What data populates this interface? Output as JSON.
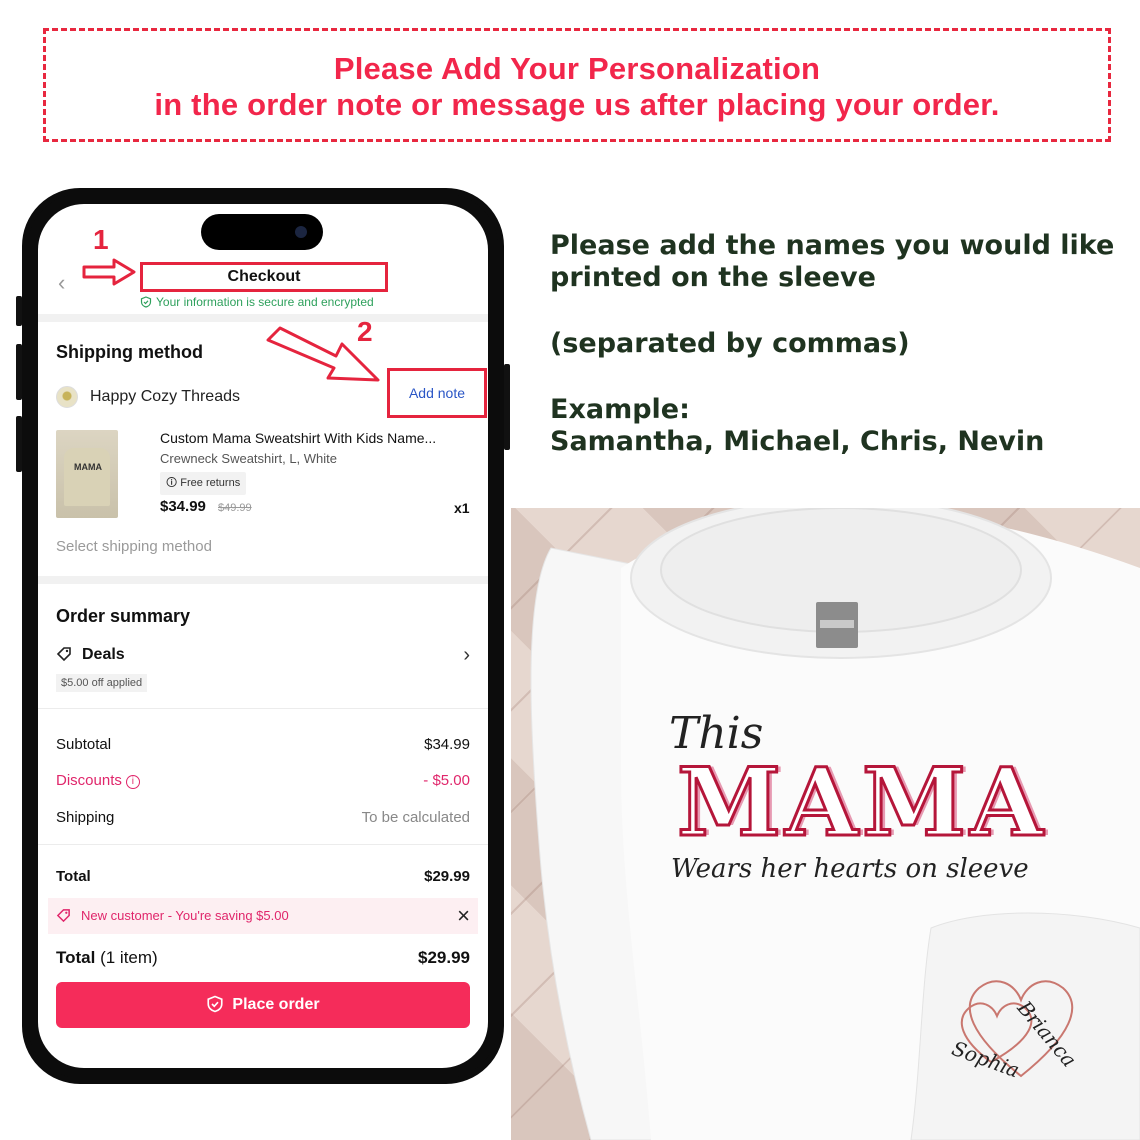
{
  "banner": {
    "line1": "Please Add Your Personalization",
    "line2": "in the order note or message us after placing your order."
  },
  "instructions": {
    "line1": "Please add the names you would like",
    "line2": "printed on the sleeve",
    "note": "(separated by commas)",
    "example_label": "Example:",
    "example_names": "Samantha, Michael, Chris, Nevin"
  },
  "callouts": {
    "step1": "1",
    "step2": "2"
  },
  "phone": {
    "title": "Checkout",
    "secure_text": "Your information is secure and encrypted",
    "shipping_title": "Shipping method",
    "shop_name": "Happy Cozy Threads",
    "add_note": "Add note",
    "product": {
      "name": "Custom Mama Sweatshirt With Kids Name...",
      "variant": "Crewneck Sweatshirt, L, White",
      "badge": "Free returns",
      "price": "$34.99",
      "original_price": "$49.99",
      "qty": "x1",
      "thumb_text": "MAMA"
    },
    "select_shipping": "Select shipping method",
    "summary_title": "Order summary",
    "deals_label": "Deals",
    "deals_badge": "$5.00 off applied",
    "subtotal_label": "Subtotal",
    "subtotal_value": "$34.99",
    "discounts_label": "Discounts",
    "discounts_value": "- $5.00",
    "shipping_label": "Shipping",
    "shipping_value": "To be calculated",
    "total_label": "Total",
    "total_value": "$29.99",
    "promo_text": "New customer - You're saving $5.00",
    "total_items_label": "Total",
    "total_items_count": "(1 item)",
    "total_items_value": "$29.99",
    "place_order": "Place order"
  },
  "shirt": {
    "script_top": "This",
    "big_word": "MAMA",
    "script_bottom": "Wears her hearts on sleeve",
    "sleeve_name1": "Brianca",
    "sleeve_name2": "Sophia"
  },
  "colors": {
    "banner_red": "#f2264b",
    "instruction_green": "#1f3320",
    "tiktok_pink": "#f52c5a",
    "mama_red": "#b5163a",
    "mama_pink": "#e79ab2"
  }
}
